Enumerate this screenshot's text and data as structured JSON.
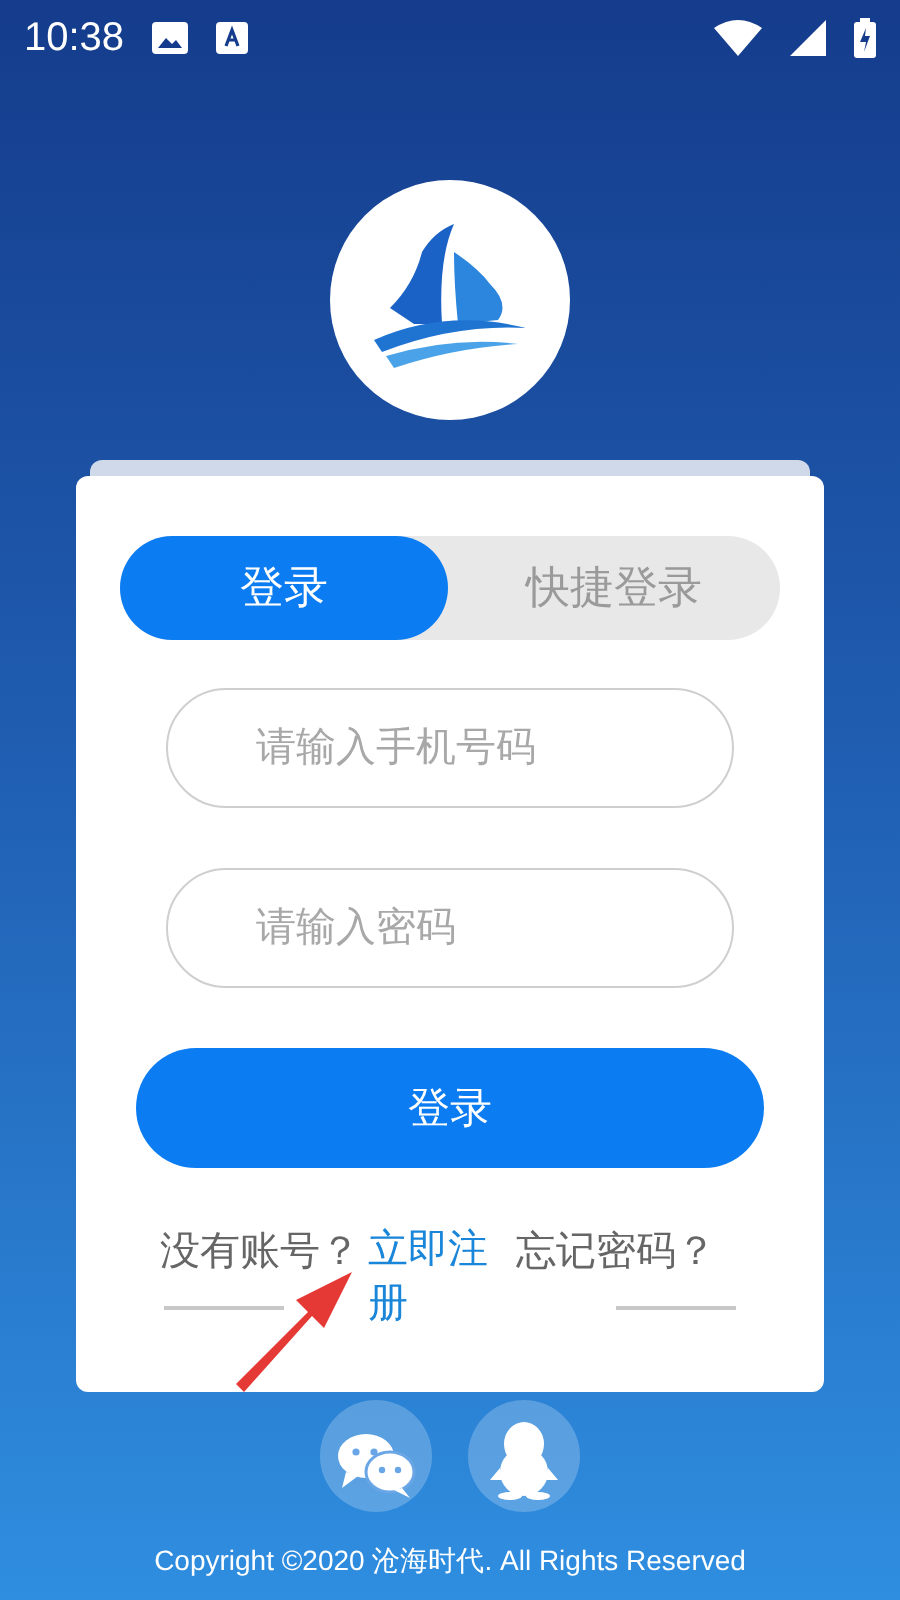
{
  "status_bar": {
    "time": "10:38"
  },
  "tabs": [
    {
      "label": "登录",
      "selected": true
    },
    {
      "label": "快捷登录",
      "selected": false
    }
  ],
  "fields": [
    {
      "placeholder": "请输入手机号码"
    },
    {
      "placeholder": "请输入密码"
    }
  ],
  "submit_button": "登录",
  "register_prompt": "没有账号？",
  "register_link": "立即注册",
  "forgot_link": "忘记密码？",
  "social": [
    {
      "kind": "wechat"
    },
    {
      "kind": "qq"
    }
  ],
  "copyright": "Copyright ©2020 沧海时代. All Rights Reserved"
}
